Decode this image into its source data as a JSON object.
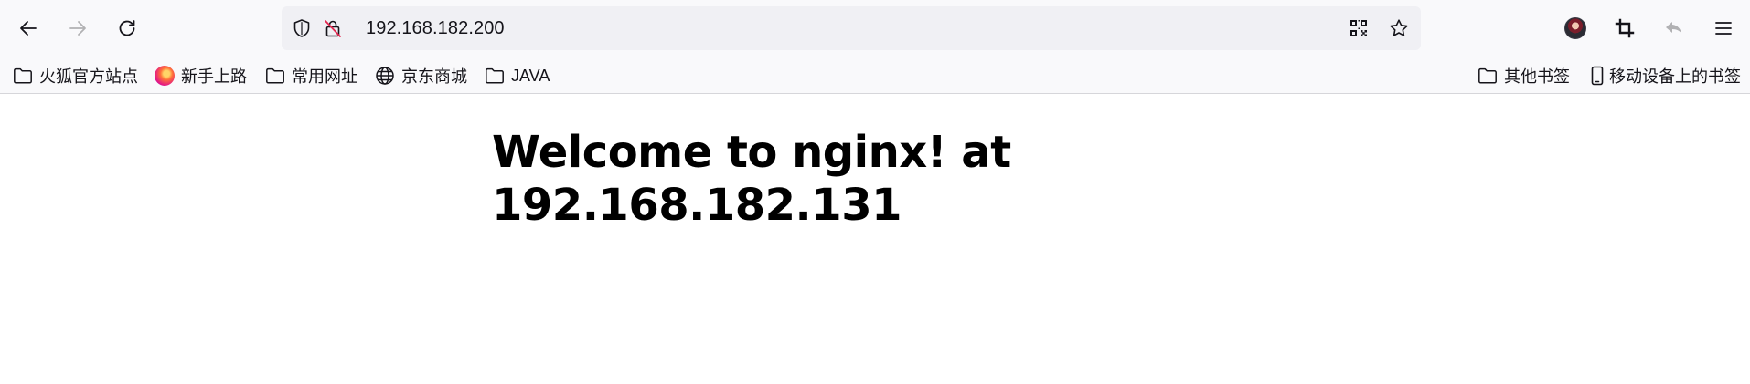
{
  "toolbar": {
    "back_icon": "arrow-left-icon",
    "forward_icon": "arrow-right-icon",
    "reload_icon": "reload-icon",
    "url": "192.168.182.200",
    "site_info_icon": "shield-icon",
    "insecure_icon": "lock-strikethrough-icon",
    "qr_icon": "qr-code-icon",
    "bookmark_star_icon": "star-icon",
    "account_icon": "avatar",
    "screenshot_icon": "crop-icon",
    "undo_icon": "undo-icon",
    "menu_icon": "hamburger-menu-icon"
  },
  "bookmarks": {
    "left": [
      {
        "label": "火狐官方站点",
        "icon": "folder-icon"
      },
      {
        "label": "新手上路",
        "icon": "firefox-icon"
      },
      {
        "label": "常用网址",
        "icon": "folder-icon"
      },
      {
        "label": "京东商城",
        "icon": "globe-icon"
      },
      {
        "label": "JAVA",
        "icon": "folder-icon"
      }
    ],
    "right": [
      {
        "label": "其他书签",
        "icon": "folder-icon"
      },
      {
        "label": "移动设备上的书签",
        "icon": "mobile-icon"
      }
    ]
  },
  "page": {
    "heading": "Welcome to nginx! at 192.168.182.131"
  },
  "colors": {
    "chrome_bg": "#f9f9fb",
    "urlbar_bg": "#f0f0f4",
    "text": "#15141a",
    "disabled_icon": "#b1b1b3"
  }
}
